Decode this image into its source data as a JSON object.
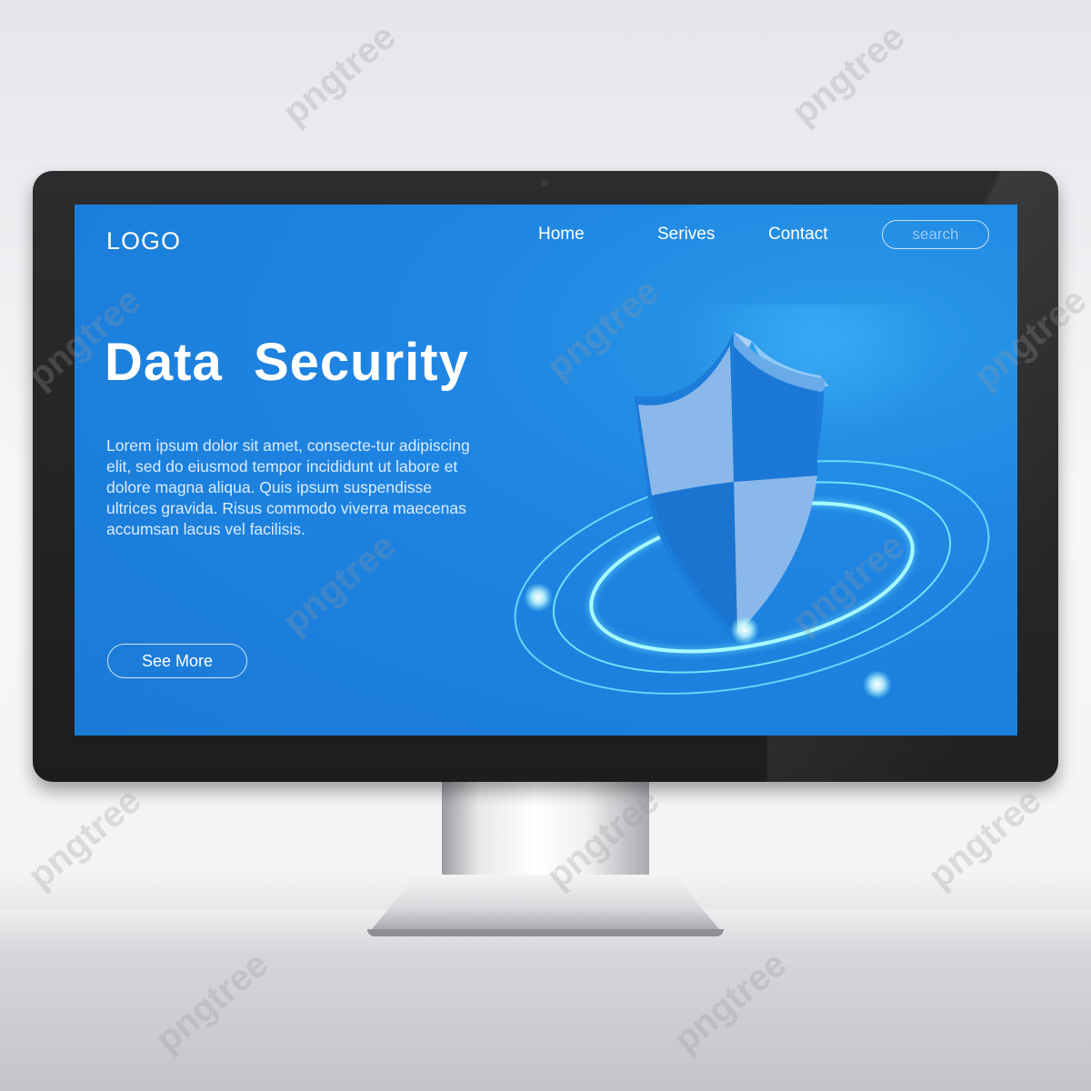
{
  "nav": {
    "logo": "LOGO",
    "items": [
      "Home",
      "Serives",
      "Contact"
    ],
    "search_placeholder": "search"
  },
  "hero": {
    "title": "Data  Security",
    "body": "Lorem ipsum dolor sit amet, consecte-tur adipiscing elit, sed do eiusmod tempor incididunt ut labore et dolore magna aliqua. Quis ipsum suspendisse ultrices gravida. Risus commodo viverra maecenas accumsan lacus vel facilisis.",
    "button_label": "See More"
  },
  "illustration": {
    "icon": "shield-icon",
    "rings": "orbit-rings"
  },
  "watermark": "pngtree",
  "colors": {
    "screen_blue": "#1f86e3",
    "shield_light": "#8ab8ea",
    "shield_dark": "#1b78d6",
    "ring_glow": "#7ff2ff",
    "bezel": "#1d1d1f"
  }
}
